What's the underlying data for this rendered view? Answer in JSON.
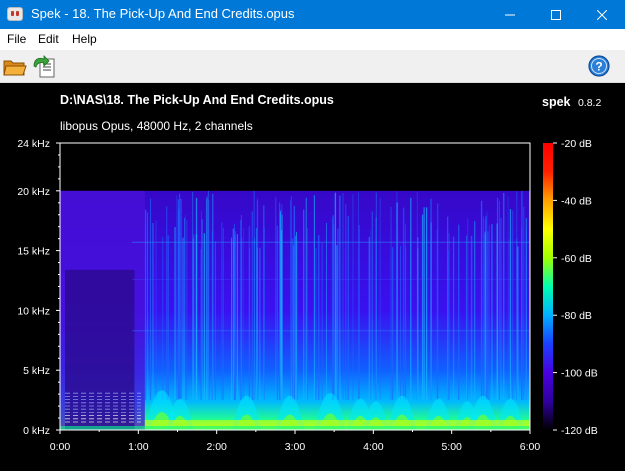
{
  "window": {
    "title": "Spek - 18. The Pick-Up And End Credits.opus",
    "controls": [
      "minimize",
      "maximize",
      "close"
    ]
  },
  "menu": {
    "items": [
      "File",
      "Edit",
      "Help"
    ]
  },
  "toolbar": {
    "icons": [
      "open-folder-icon",
      "save-image-icon",
      "help-icon"
    ]
  },
  "header": {
    "file_path": "D:\\NAS\\18. The Pick-Up And End Credits.opus",
    "codec_info": "libopus Opus, 48000 Hz, 2 channels",
    "app_name": "spek",
    "app_version": "0.8.2"
  },
  "chart_data": {
    "type": "heatmap",
    "title": "D:\\NAS\\18. The Pick-Up And End Credits.opus",
    "subtitle": "libopus Opus, 48000 Hz, 2 channels",
    "x_ticks": [
      "0:00",
      "1:00",
      "2:00",
      "3:00",
      "4:00",
      "5:00",
      "6:00"
    ],
    "x_range_seconds": [
      0,
      360
    ],
    "y_ticks": [
      "0 kHz",
      "5 kHz",
      "10 kHz",
      "15 kHz",
      "20 kHz",
      "24 kHz"
    ],
    "y_range_khz": [
      0,
      24
    ],
    "legend_ticks": [
      "-20 dB",
      "-40 dB",
      "-60 dB",
      "-80 dB",
      "-100 dB",
      "-120 dB"
    ],
    "legend_range_db": [
      -120,
      -20
    ],
    "legend_placement": "right",
    "cutoff_khz": 20,
    "colormap": [
      "#000000",
      "#3000a0",
      "#4a00e0",
      "#1a40ff",
      "#00b0ff",
      "#00ffb0",
      "#a0ff00",
      "#ffff00",
      "#ffa000",
      "#ff2000",
      "#ff0000"
    ]
  }
}
